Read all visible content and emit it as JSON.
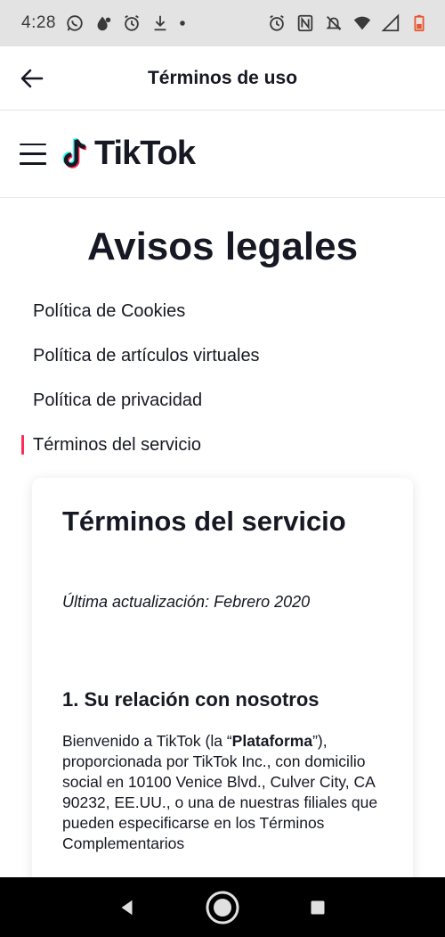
{
  "status_bar": {
    "time": "4:28",
    "left_icons": [
      "whatsapp-icon",
      "drop-icon",
      "alarm-icon",
      "download-icon",
      "dot-icon"
    ],
    "right_icons": [
      "alarm-icon",
      "nfc-icon",
      "mute-icon",
      "wifi-icon",
      "signal-icon",
      "battery-icon"
    ]
  },
  "header": {
    "title": "Términos de uso"
  },
  "site_nav": {
    "logo_text": "TikTok"
  },
  "page": {
    "heading": "Avisos legales",
    "legal_links": [
      {
        "label": "Política de Cookies",
        "active": false
      },
      {
        "label": "Política de artículos virtuales",
        "active": false
      },
      {
        "label": "Política de privacidad",
        "active": false
      },
      {
        "label": "Términos del servicio",
        "active": true
      }
    ]
  },
  "card": {
    "title": "Términos del servicio",
    "updated": "Última actualización: Febrero 2020",
    "section_title": "1. Su relación con nosotros",
    "body_pre": "Bienvenido a TikTok (la “",
    "body_bold": "Plataforma",
    "body_post": "”), proporcionada por TikTok Inc., con domicilio social en 10100 Venice Blvd., Culver City, CA 90232, EE.UU., o una de nuestras filiales que pueden especificarse en los Términos Complementarios"
  },
  "colors": {
    "accent": "#fe2c55",
    "logo_cyan": "#25f4ee",
    "text": "#161823",
    "status_bar_bg": "#e3e3e3",
    "battery": "#e8552f"
  }
}
